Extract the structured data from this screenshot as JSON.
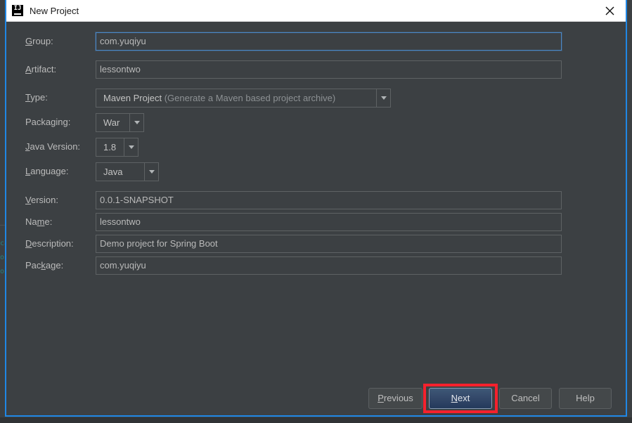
{
  "window": {
    "title": "New Project",
    "app_icon": "intellij-idea-icon",
    "close_icon": "close-icon",
    "border_color": "#1f87e5"
  },
  "backdrop": {
    "code_fragments": [
      "ca",
      "ob",
      "ob"
    ]
  },
  "form": {
    "fields": [
      {
        "label": "Group:",
        "mnemonic": "G",
        "value": "com.yuqiyu",
        "focused": true,
        "name": "group"
      },
      {
        "label": "Artifact:",
        "mnemonic": "A",
        "value": "lessontwo",
        "focused": false,
        "name": "artifact"
      },
      {
        "label": "Version:",
        "mnemonic": "V",
        "value": "0.0.1-SNAPSHOT",
        "focused": false,
        "name": "version"
      },
      {
        "label": "Name:",
        "mnemonic": "m",
        "value": "lessontwo",
        "focused": false,
        "name": "name"
      },
      {
        "label": "Description:",
        "mnemonic": "D",
        "value": "Demo project for Spring Boot",
        "focused": false,
        "name": "description"
      },
      {
        "label": "Package:",
        "mnemonic": "k",
        "value": "com.yuqiyu",
        "focused": false,
        "name": "package"
      }
    ],
    "combos": [
      {
        "label": "Type:",
        "mnemonic": "T",
        "value": "Maven Project",
        "value_detail": "(Generate a Maven based project archive)",
        "name": "type",
        "arrow_icon": "chevron-down-icon"
      },
      {
        "label": "Packaging:",
        "mnemonic": "g",
        "value": "War",
        "value_detail": "",
        "name": "packaging",
        "arrow_icon": "chevron-down-icon"
      },
      {
        "label": "Java Version:",
        "mnemonic": "J",
        "value": "1.8",
        "value_detail": "",
        "name": "java-version",
        "arrow_icon": "chevron-down-icon"
      },
      {
        "label": "Language:",
        "mnemonic": "L",
        "value": "Java",
        "value_detail": "",
        "name": "language",
        "arrow_icon": "chevron-down-icon"
      }
    ]
  },
  "buttons": [
    {
      "label": "Previous",
      "mnemonic": "P",
      "default": false,
      "name": "previous"
    },
    {
      "label": "Next",
      "mnemonic": "N",
      "default": true,
      "name": "next"
    },
    {
      "label": "Cancel",
      "mnemonic": "",
      "default": false,
      "name": "cancel"
    },
    {
      "label": "Help",
      "mnemonic": "",
      "default": false,
      "name": "help"
    }
  ],
  "annotation": {
    "type": "red-rectangle-highlight",
    "target": "Next",
    "color": "#f5212d"
  }
}
